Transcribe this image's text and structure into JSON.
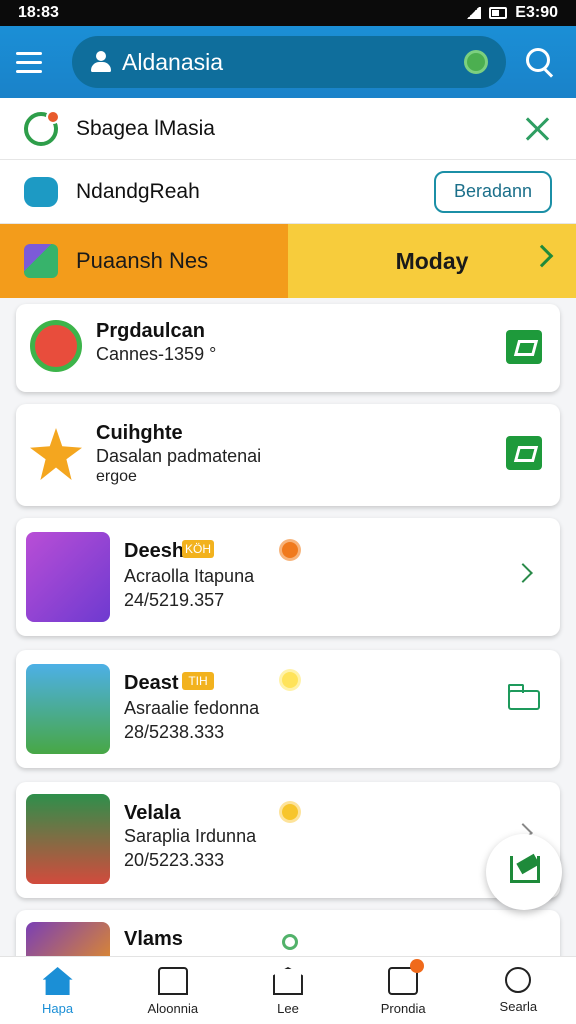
{
  "status_bar": {
    "time": "18:83",
    "right_text": "E3:90"
  },
  "app_bar": {
    "account_name": "Aldanasia"
  },
  "notifications": [
    {
      "text": "Sbagea lMasia"
    },
    {
      "text": "NdandgReah",
      "button_label": "Beradann"
    }
  ],
  "promo": {
    "title": "Puaansh Nes",
    "day": "Moday"
  },
  "cards": [
    {
      "title": "Prgdaulcan",
      "subtitle": "Cannes-1359 °"
    },
    {
      "title": "Cuihghte",
      "subtitle": "Dasalan padmatenai",
      "extra": "ergoe"
    },
    {
      "title": "Deesh",
      "tag": "KÖH",
      "subtitle": "Acraolla Itapuna",
      "date": "24/5219.357"
    },
    {
      "title": "Deast",
      "tag": "TIH",
      "subtitle": "Asraalie fedonna",
      "date": "28/5238.333"
    },
    {
      "title": "Velala",
      "subtitle": "Saraplia Irdunna",
      "date": "20/5223.333"
    },
    {
      "title": "Vlams"
    }
  ],
  "bottom_nav": [
    {
      "label": "Hapa"
    },
    {
      "label": "Aloonnia"
    },
    {
      "label": "Lee"
    },
    {
      "label": "Prondia"
    },
    {
      "label": "Searla"
    }
  ],
  "colors": {
    "primary": "#1b8fd6",
    "accent_green": "#1e9a3b",
    "promo_orange": "#f39c1b",
    "promo_yellow": "#f7cc3c"
  }
}
